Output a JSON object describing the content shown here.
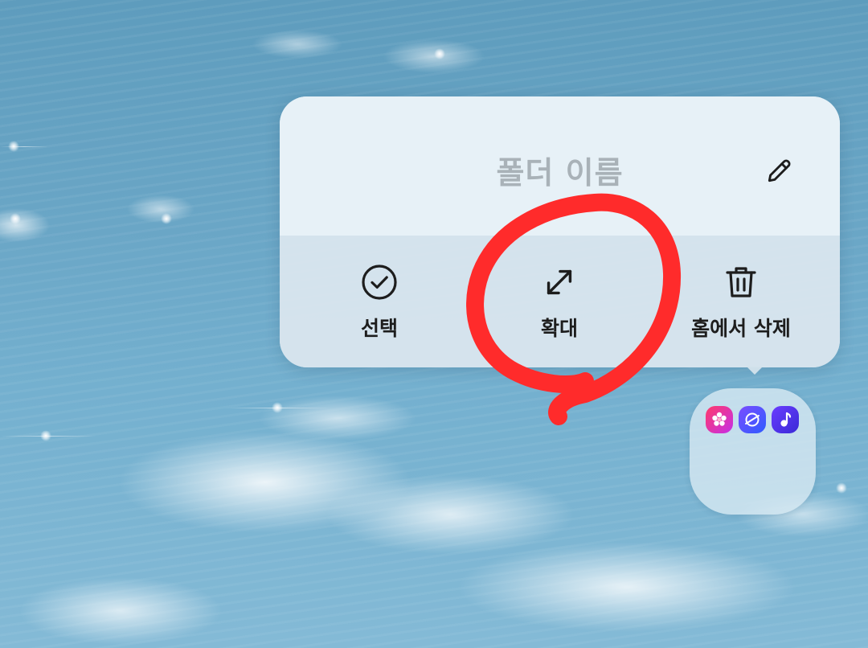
{
  "folder_popup": {
    "name_placeholder": "폴더 이름",
    "edit_icon": "pencil-icon",
    "actions": [
      {
        "id": "select",
        "label": "선택",
        "icon": "check-circle-icon"
      },
      {
        "id": "expand",
        "label": "확대",
        "icon": "expand-arrows-icon"
      },
      {
        "id": "remove",
        "label": "홈에서 삭제",
        "icon": "trash-icon"
      }
    ]
  },
  "folder_icon": {
    "apps": [
      {
        "name": "gallery-app-icon",
        "color": "#e8336f"
      },
      {
        "name": "internet-app-icon",
        "color": "#4b52ff"
      },
      {
        "name": "music-app-icon",
        "color": "#4a2fe0"
      }
    ]
  },
  "annotation": {
    "color": "#ff2b2b",
    "target": "expand"
  },
  "colors": {
    "popup_background": "#e2eef4",
    "label_text": "#1d1d1d",
    "placeholder_text": "#a9b2b8"
  }
}
